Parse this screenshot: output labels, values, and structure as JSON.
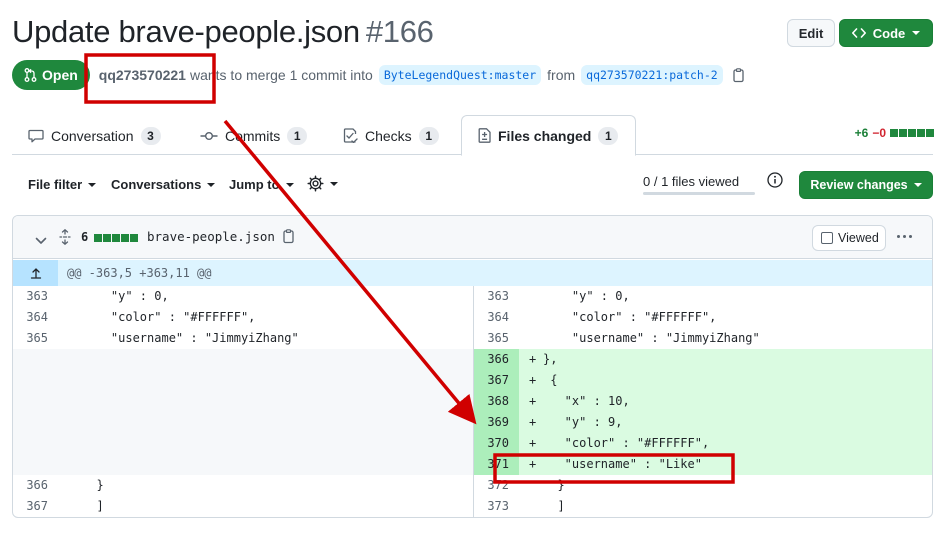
{
  "pr": {
    "title": "Update brave-people.json",
    "number": "#166",
    "state": "Open",
    "author": "qq273570221",
    "merge_text": "wants to merge 1 commit into",
    "base_branch": "ByteLegendQuest:master",
    "from_text": "from",
    "head_branch": "qq273570221:patch-2"
  },
  "header_buttons": {
    "edit": "Edit",
    "code": "Code"
  },
  "tabs": [
    {
      "label": "Conversation",
      "count": "3"
    },
    {
      "label": "Commits",
      "count": "1"
    },
    {
      "label": "Checks",
      "count": "1"
    },
    {
      "label": "Files changed",
      "count": "1",
      "active": true
    }
  ],
  "diffstat": {
    "additions": "+6",
    "deletions": "−0"
  },
  "toolbar": {
    "file_filter": "File filter",
    "conversations": "Conversations",
    "jump_to": "Jump to",
    "files_viewed": "0 / 1 files viewed",
    "files_viewed_progress": 0,
    "review_changes": "Review changes"
  },
  "file": {
    "changes": "6",
    "name": "brave-people.json",
    "viewed_label": "Viewed",
    "hunk_header": "@@ -363,5 +363,11 @@"
  },
  "diff_rows": [
    {
      "l": "363",
      "lc": "    \"y\" : 0,",
      "r": "363",
      "rc": "    \"y\" : 0,",
      "type": "ctx"
    },
    {
      "l": "364",
      "lc": "    \"color\" : \"#FFFFFF\",",
      "r": "364",
      "rc": "    \"color\" : \"#FFFFFF\",",
      "type": "ctx"
    },
    {
      "l": "365",
      "lc": "    \"username\" : \"JimmyiZhang\"",
      "r": "365",
      "rc": "    \"username\" : \"JimmyiZhang\"",
      "type": "ctx"
    },
    {
      "l": "",
      "lc": "",
      "r": "366",
      "rc": "},",
      "type": "add"
    },
    {
      "l": "",
      "lc": "",
      "r": "367",
      "rc": " {",
      "type": "add"
    },
    {
      "l": "",
      "lc": "",
      "r": "368",
      "rc": "   \"x\" : 10,",
      "type": "add"
    },
    {
      "l": "",
      "lc": "",
      "r": "369",
      "rc": "   \"y\" : 9,",
      "type": "add"
    },
    {
      "l": "",
      "lc": "",
      "r": "370",
      "rc": "   \"color\" : \"#FFFFFF\",",
      "type": "add"
    },
    {
      "l": "",
      "lc": "",
      "r": "371",
      "rc": "   \"username\" : \"Like\"",
      "type": "add"
    },
    {
      "l": "366",
      "lc": "  }",
      "r": "372",
      "rc": "  }",
      "type": "ctx"
    },
    {
      "l": "367",
      "lc": "  ]",
      "r": "373",
      "rc": "  ]",
      "type": "ctx"
    }
  ],
  "colors": {
    "primary_green": "#1f883d",
    "addition_bg": "#dafbe1",
    "addition_gutter": "#aceebb",
    "hunk_bg": "#ddf4ff",
    "annotation_red": "#d00000"
  }
}
